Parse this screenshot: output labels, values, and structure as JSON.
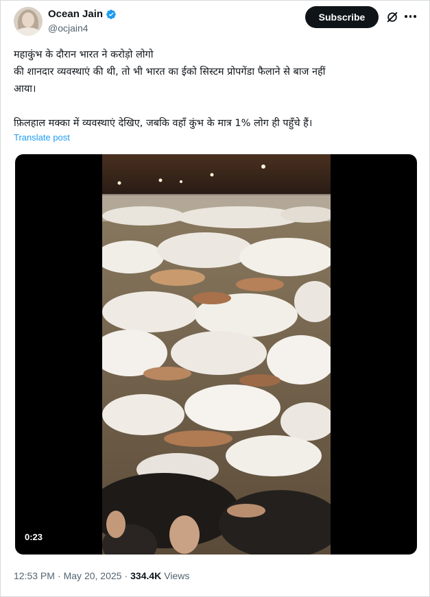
{
  "author": {
    "display_name": "Ocean Jain",
    "handle": "@ocjain4",
    "verified_color": "#1d9bf0"
  },
  "header": {
    "subscribe_label": "Subscribe",
    "grok_icon": "grok-slash-icon",
    "more_icon": "more-dots-icon"
  },
  "post": {
    "line1": "महाकुंभ के दौरान भारत ने करोड़ो लोगो",
    "line2": "की शानदार व्यवस्थाएं की थी, तो भी भारत का ईको सिस्टम प्रोपगेंडा फैलाने से बाज नहीं",
    "line3": "आया।",
    "line4": "फ़िलहाल मक्का में व्यवस्थाएं देखिए, जबकि वहाँ कुंभ  के मात्र 1% लोग ही पहुँचे हैं।",
    "translate_label": "Translate post"
  },
  "media": {
    "duration": "0:23"
  },
  "footer": {
    "time": "12:53 PM",
    "separator1": "·",
    "date": "May 20, 2025",
    "separator2": "·",
    "views_count": "334.4K",
    "views_label": "Views"
  },
  "colors": {
    "text_primary": "#0f1419",
    "text_secondary": "#536471",
    "link": "#1d9bf0",
    "button_bg": "#0f1419"
  }
}
